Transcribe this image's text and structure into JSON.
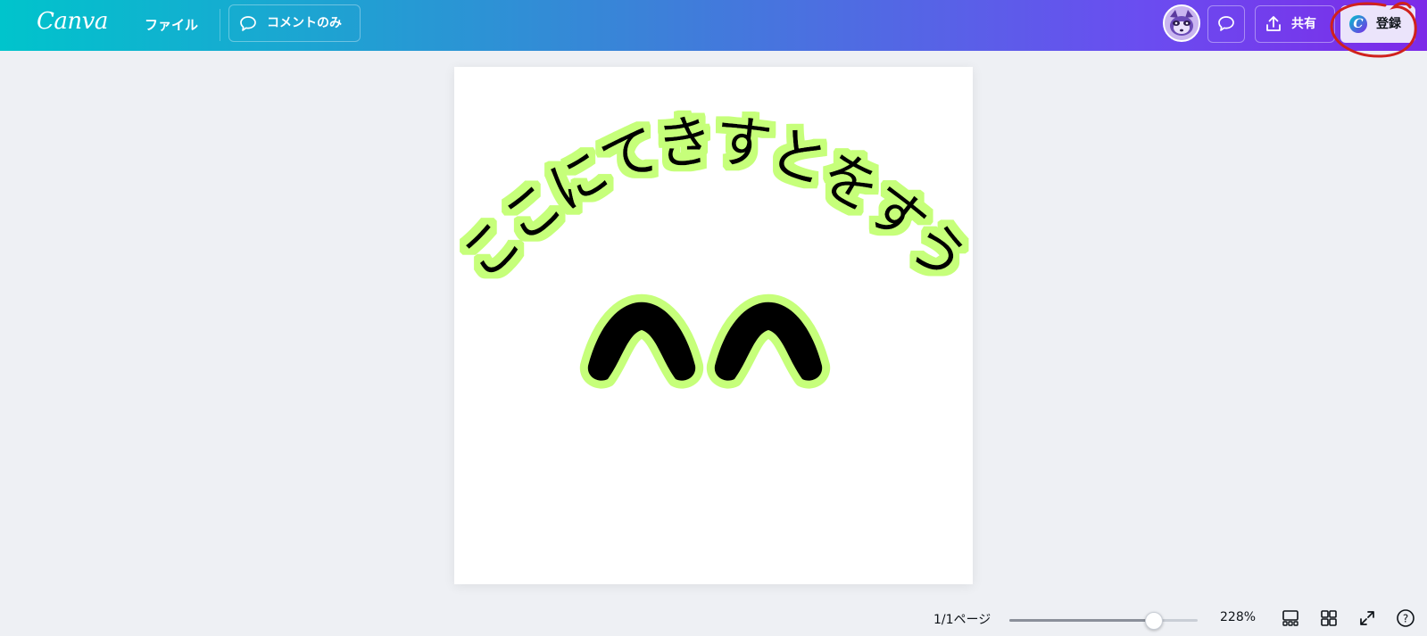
{
  "header": {
    "logo": "Canva",
    "file_menu": "ファイル",
    "comment_mode": {
      "icon": "speech-bubble-icon",
      "label": "コメントのみ"
    },
    "avatar": {
      "icon": "raccoon-avatar-icon"
    },
    "comments_button": {
      "icon": "speech-bubble-icon"
    },
    "share_button": {
      "icon": "upload-share-icon",
      "label": "共有"
    },
    "signup_button": {
      "icon": "canva-c-icon",
      "icon_glyph": "C",
      "label": "登録"
    },
    "gradient_colors": [
      "#00c4cc",
      "#3b82d8",
      "#6a4df0",
      "#7d2ae8"
    ]
  },
  "annotation": {
    "color": "#d0211c",
    "shape": "hand-drawn-circle"
  },
  "design": {
    "curved_text": "ここにてきすとをすう",
    "glow_color": "#c6ff7a",
    "text_color": "#000000",
    "shape": "double-caret-shape"
  },
  "footer": {
    "page_indicator": "1/1ページ",
    "zoom": {
      "value": "228%",
      "level_percent": 77
    },
    "icons": [
      "page-thumbnails-icon",
      "grid-view-icon",
      "fullscreen-icon",
      "help-icon"
    ],
    "help_glyph": "?"
  }
}
